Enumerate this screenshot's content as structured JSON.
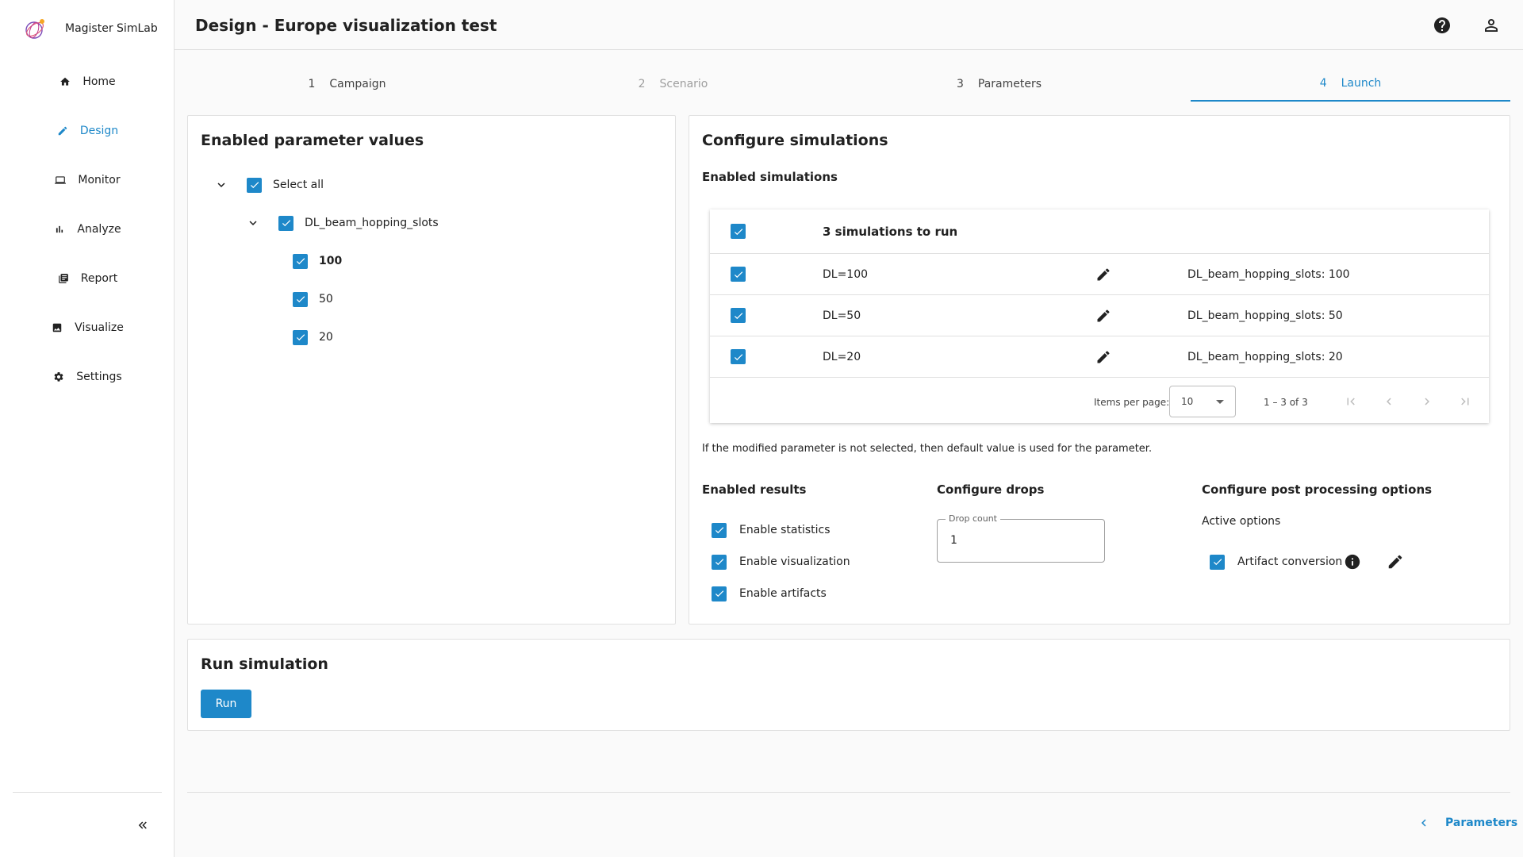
{
  "app": {
    "name": "Magister SimLab"
  },
  "nav": {
    "items": [
      {
        "label": "Home",
        "icon": "home-icon",
        "active": false
      },
      {
        "label": "Design",
        "icon": "pencil-icon",
        "active": true
      },
      {
        "label": "Monitor",
        "icon": "monitor-icon",
        "active": false
      },
      {
        "label": "Analyze",
        "icon": "bar-chart-icon",
        "active": false
      },
      {
        "label": "Report",
        "icon": "report-icon",
        "active": false
      },
      {
        "label": "Visualize",
        "icon": "image-icon",
        "active": false
      },
      {
        "label": "Settings",
        "icon": "gear-icon",
        "active": false
      }
    ]
  },
  "header": {
    "title": "Design - Europe visualization test"
  },
  "stepper": {
    "steps": [
      {
        "num": "1",
        "label": "Campaign",
        "state": "done"
      },
      {
        "num": "2",
        "label": "Scenario",
        "state": "disabled"
      },
      {
        "num": "3",
        "label": "Parameters",
        "state": "done"
      },
      {
        "num": "4",
        "label": "Launch",
        "state": "active"
      }
    ]
  },
  "params_card": {
    "title": "Enabled parameter values",
    "select_all": "Select all",
    "group": "DL_beam_hopping_slots",
    "values": [
      "100",
      "50",
      "20"
    ]
  },
  "configure": {
    "title": "Configure simulations",
    "enabled_simulations": "Enabled simulations",
    "table_header": "3 simulations to run",
    "rows": [
      {
        "name": "DL=100",
        "params": "DL_beam_hopping_slots: 100"
      },
      {
        "name": "DL=50",
        "params": "DL_beam_hopping_slots: 50"
      },
      {
        "name": "DL=20",
        "params": "DL_beam_hopping_slots: 20"
      }
    ],
    "paginator": {
      "items_per_page_label": "Items per page:",
      "items_per_page": "10",
      "range": "1 – 3 of 3"
    },
    "note": "If the modified parameter is not selected, then default value is used for the parameter.",
    "results": {
      "title": "Enabled results",
      "options": [
        "Enable statistics",
        "Enable visualization",
        "Enable artifacts"
      ]
    },
    "drops": {
      "title": "Configure drops",
      "label": "Drop count",
      "value": "1"
    },
    "post": {
      "title": "Configure post processing options",
      "subtitle": "Active options",
      "option": "Artifact conversion"
    }
  },
  "run": {
    "title": "Run simulation",
    "button": "Run"
  },
  "footer": {
    "back_label": "Parameters"
  },
  "colors": {
    "accent": "#1e88c9"
  }
}
